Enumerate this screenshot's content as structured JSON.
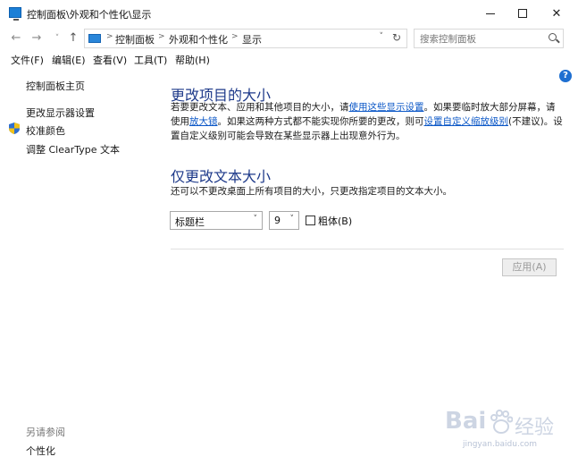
{
  "window": {
    "title": "控制面板\\外观和个性化\\显示",
    "minimize_glyph": "—",
    "maximize_glyph": "□",
    "close_glyph": "✕"
  },
  "nav": {
    "back_glyph": "←",
    "forward_glyph": "→",
    "recent_glyph": "˅",
    "up_glyph": "↑",
    "breadcrumbs": [
      "控制面板",
      "外观和个性化",
      "显示"
    ],
    "separator": ">",
    "dropdown_glyph": "˅",
    "refresh_glyph": "↻",
    "search_placeholder": "搜索控制面板"
  },
  "menu": [
    "文件(F)",
    "编辑(E)",
    "查看(V)",
    "工具(T)",
    "帮助(H)"
  ],
  "help_glyph": "?",
  "sidebar": {
    "items": [
      "控制面板主页",
      "更改显示器设置",
      "校准颜色",
      "调整 ClearType 文本"
    ],
    "see_also_heading": "另请参阅",
    "see_also_items": [
      "个性化"
    ]
  },
  "main": {
    "section1": {
      "heading": "更改项目的大小",
      "text_a": "若要更改文本、应用和其他项目的大小，请",
      "link_a": "使用这些显示设置",
      "text_b": "。如果要临时放大部分屏幕，请使用",
      "link_b": "放大镜",
      "text_c": "。如果这两种方式都不能实现你所要的更改，则可",
      "link_c": "设置自定义缩放级别",
      "text_d": "(不建议)。设置自定义级别可能会导致在某些显示器上出现意外行为。"
    },
    "section2": {
      "heading": "仅更改文本大小",
      "description": "还可以不更改桌面上所有项目的大小，只更改指定项目的文本大小。",
      "item_select": "标题栏",
      "size_select": "9",
      "bold_label": "粗体(B)",
      "bold_checked": false,
      "chevron": "˅"
    },
    "apply_label": "应用(A)"
  },
  "watermark": {
    "brand": "Bai",
    "brand2": "经验",
    "url": "jingyan.baidu.com"
  }
}
